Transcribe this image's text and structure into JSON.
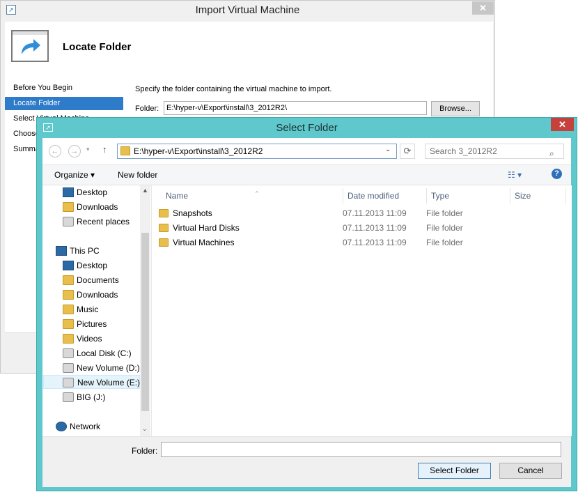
{
  "wizard": {
    "title": "Import Virtual Machine",
    "close_glyph": "✕",
    "heading": "Locate Folder",
    "nav_items": [
      {
        "label": "Before You Begin",
        "selected": false
      },
      {
        "label": "Locate Folder",
        "selected": true
      },
      {
        "label": "Select Virtual Machine",
        "selected": false
      },
      {
        "label": "Choose Import Type",
        "selected": false
      },
      {
        "label": "Summary",
        "selected": false
      }
    ],
    "description": "Specify the folder containing the virtual machine to import.",
    "folder_label": "Folder:",
    "folder_value": "E:\\hyper-v\\Export\\install\\3_2012R2\\",
    "browse_label": "Browse..."
  },
  "dialog": {
    "title": "Select Folder",
    "close_glyph": "✕",
    "address": {
      "back_glyph": "←",
      "forward_glyph": "→",
      "recent_glyph": "▾",
      "up_glyph": "↑",
      "path": "E:\\hyper-v\\Export\\install\\3_2012R2",
      "dropdown_glyph": "⌄",
      "refresh_glyph": "⟳"
    },
    "search": {
      "placeholder": "Search 3_2012R2",
      "icon_glyph": "⌕"
    },
    "toolbar": {
      "organize_label": "Organize ▾",
      "new_folder_label": "New folder",
      "view_glyph": "☷ ▾",
      "help_glyph": "?"
    },
    "nav_tree": [
      {
        "label": "Desktop",
        "icon": "desktop-icon"
      },
      {
        "label": "Downloads",
        "icon": "downloads-icon"
      },
      {
        "label": "Recent places",
        "icon": "recent-places-icon"
      },
      {
        "label": "This PC",
        "icon": "this-pc-icon"
      },
      {
        "label": "Desktop",
        "icon": "desktop-icon"
      },
      {
        "label": "Documents",
        "icon": "documents-icon"
      },
      {
        "label": "Downloads",
        "icon": "downloads-icon"
      },
      {
        "label": "Music",
        "icon": "music-icon"
      },
      {
        "label": "Pictures",
        "icon": "pictures-icon"
      },
      {
        "label": "Videos",
        "icon": "videos-icon"
      },
      {
        "label": "Local Disk (C:)",
        "icon": "local-disk-icon"
      },
      {
        "label": "New Volume (D:)",
        "icon": "drive-icon"
      },
      {
        "label": "New Volume (E:)",
        "icon": "drive-icon",
        "selected": true
      },
      {
        "label": "BIG (J:)",
        "icon": "drive-icon"
      },
      {
        "label": "Network",
        "icon": "network-icon"
      }
    ],
    "scroll": {
      "up_glyph": "▲",
      "down_glyph": "⌄"
    },
    "columns": {
      "name": "Name",
      "date": "Date modified",
      "type": "Type",
      "size": "Size",
      "sort_glyph": "^"
    },
    "files": [
      {
        "name": "Snapshots",
        "date": "07.11.2013 11:09",
        "type": "File folder"
      },
      {
        "name": "Virtual Hard Disks",
        "date": "07.11.2013 11:09",
        "type": "File folder"
      },
      {
        "name": "Virtual Machines",
        "date": "07.11.2013 11:09",
        "type": "File folder"
      }
    ],
    "folder_label": "Folder:",
    "folder_value": "",
    "select_label": "Select Folder",
    "cancel_label": "Cancel"
  }
}
